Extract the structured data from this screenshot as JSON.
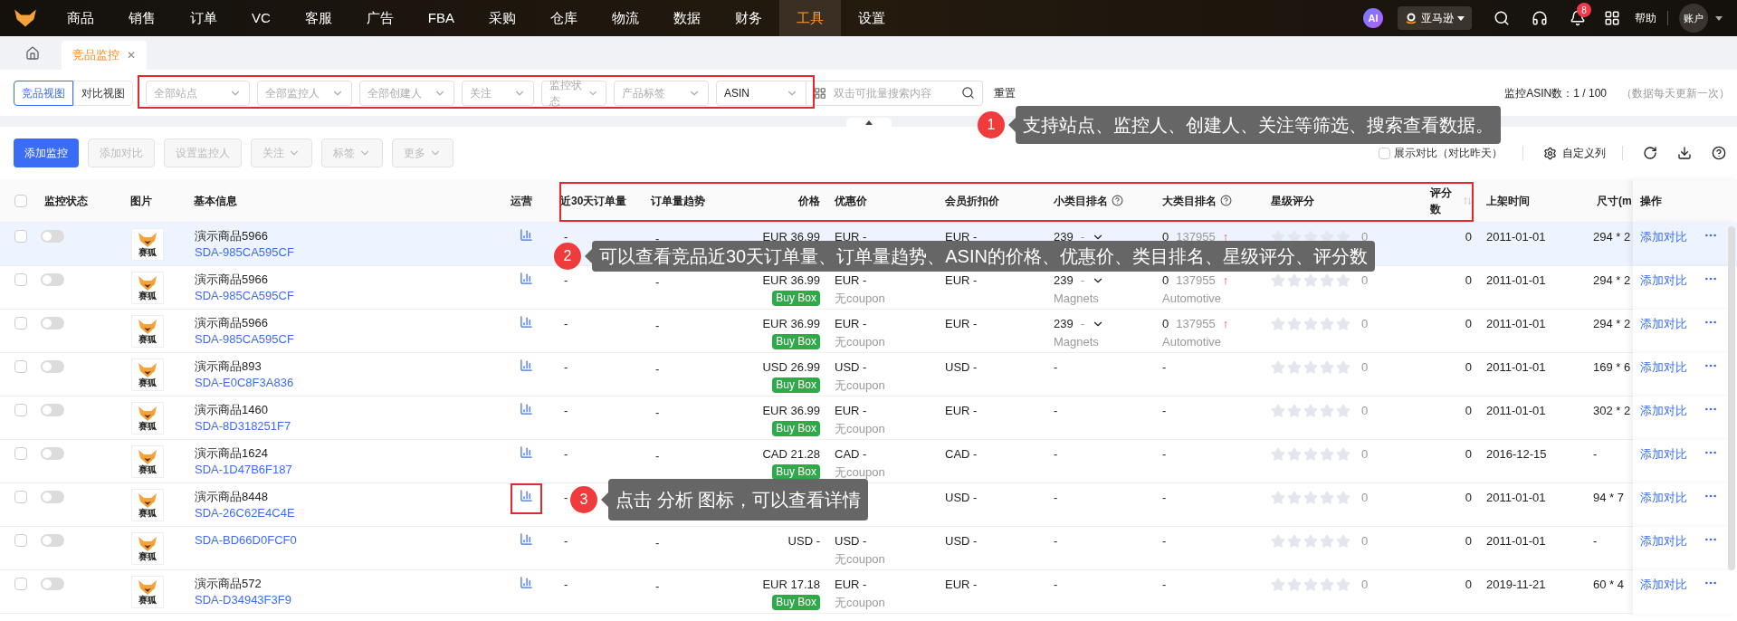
{
  "nav": {
    "items": [
      {
        "label": "商品",
        "selected": false
      },
      {
        "label": "销售",
        "selected": false
      },
      {
        "label": "订单",
        "selected": false
      },
      {
        "label": "VC",
        "selected": false
      },
      {
        "label": "客服",
        "selected": false
      },
      {
        "label": "广告",
        "selected": false
      },
      {
        "label": "FBA",
        "selected": false
      },
      {
        "label": "采购",
        "selected": false
      },
      {
        "label": "仓库",
        "selected": false
      },
      {
        "label": "物流",
        "selected": false
      },
      {
        "label": "数据",
        "selected": false
      },
      {
        "label": "财务",
        "selected": false
      },
      {
        "label": "工具",
        "selected": true
      },
      {
        "label": "设置",
        "selected": false
      }
    ],
    "ai": "AI",
    "marketplace": "亚马逊",
    "notifications": "8",
    "help": "帮助",
    "account": "账户"
  },
  "page_tabs": [
    {
      "label": "竞品监控",
      "selected": true,
      "close": "✕"
    }
  ],
  "views": [
    {
      "label": "竞品视图",
      "selected": true
    },
    {
      "label": "对比视图",
      "selected": false
    }
  ],
  "filters": [
    {
      "placeholder": "全部站点"
    },
    {
      "placeholder": "全部监控人"
    },
    {
      "placeholder": "全部创建人"
    },
    {
      "placeholder": "关注"
    },
    {
      "placeholder": "监控状态"
    },
    {
      "placeholder": "产品标签"
    }
  ],
  "search": {
    "field": "ASIN",
    "placeholder": "双击可批量搜索内容"
  },
  "reset": "重置",
  "asin_count": "监控ASIN数：1 / 100",
  "update_note": "（数据每天更新一次）",
  "actions": [
    {
      "label": "添加监控",
      "disabled": false,
      "menu": false
    },
    {
      "label": "添加对比",
      "disabled": true,
      "menu": false
    },
    {
      "label": "设置监控人",
      "disabled": true,
      "menu": false
    },
    {
      "label": "关注",
      "disabled": true,
      "menu": true
    },
    {
      "label": "标签",
      "disabled": true,
      "menu": true
    },
    {
      "label": "更多",
      "disabled": true,
      "menu": true
    }
  ],
  "compare": {
    "label": "展示对比（对比昨天）",
    "checked": false
  },
  "custom_columns": "自定义列",
  "table": {
    "select_all_checked": false,
    "columns": [
      "监控状态",
      "图片",
      "基本信息",
      "运营",
      "近30天订单量",
      "订单量趋势",
      "价格",
      "优惠价",
      "会员折扣价",
      "小类目排名",
      "大类目排名",
      "星级评分",
      "评分数",
      "上架时间",
      "尺寸(m",
      "操作"
    ],
    "rows": [
      {
        "selected": true,
        "checked": false,
        "on": false,
        "logo": "赛狐",
        "name": "演示商品5966",
        "sku": "SDA-985CA595CF",
        "orders": "-",
        "trend": "-",
        "price": "EUR 36.99",
        "coupon": "EUR -",
        "member": "EUR -",
        "small_rank": "239",
        "small_change": "-",
        "large_rank": "0",
        "large_prev": "137955",
        "large_arrow": "↑",
        "stars": 0,
        "rating": "0",
        "reviews": "0",
        "date": "2011-01-01",
        "size": "294 * 2",
        "op": "添加对比"
      },
      {
        "selected": false,
        "checked": false,
        "on": false,
        "logo": "赛狐",
        "name": "演示商品5966",
        "sku": "SDA-985CA595CF",
        "orders": "-",
        "trend": "-",
        "price": "EUR 36.99",
        "buybox": "Buy Box",
        "coupon": "EUR -",
        "coupon_note": "无coupon",
        "member": "EUR -",
        "small_rank": "239",
        "small_change": "-",
        "small_cat": "Magnets",
        "large_rank": "0",
        "large_prev": "137955",
        "large_arrow": "↑",
        "large_cat": "Automotive",
        "stars": 0,
        "rating": "0",
        "reviews": "0",
        "date": "2011-01-01",
        "size": "294 * 2",
        "op": "添加对比"
      },
      {
        "selected": false,
        "checked": false,
        "on": false,
        "logo": "赛狐",
        "name": "演示商品5966",
        "sku": "SDA-985CA595CF",
        "orders": "-",
        "trend": "-",
        "price": "EUR 36.99",
        "buybox": "Buy Box",
        "coupon": "EUR -",
        "coupon_note": "无coupon",
        "member": "EUR -",
        "small_rank": "239",
        "small_change": "-",
        "small_cat": "Magnets",
        "large_rank": "0",
        "large_prev": "137955",
        "large_arrow": "↑",
        "large_cat": "Automotive",
        "stars": 0,
        "rating": "0",
        "reviews": "0",
        "date": "2011-01-01",
        "size": "294 * 2",
        "op": "添加对比"
      },
      {
        "selected": false,
        "checked": false,
        "on": false,
        "logo": "赛狐",
        "name": "演示商品893",
        "sku": "SDA-E0C8F3A836",
        "orders": "-",
        "trend": "-",
        "price": "USD 26.99",
        "buybox": "Buy Box",
        "coupon": "USD -",
        "coupon_note": "无coupon",
        "member": "USD -",
        "small_rank": "-",
        "large_rank": "-",
        "stars": 0,
        "rating": "0",
        "reviews": "0",
        "date": "2011-01-01",
        "size": "169 * 6",
        "op": "添加对比"
      },
      {
        "selected": false,
        "checked": false,
        "on": false,
        "logo": "赛狐",
        "name": "演示商品1460",
        "sku": "SDA-8D318251F7",
        "orders": "-",
        "trend": "-",
        "price": "EUR 36.99",
        "buybox": "Buy Box",
        "coupon": "EUR -",
        "coupon_note": "无coupon",
        "member": "EUR -",
        "small_rank": "-",
        "large_rank": "-",
        "stars": 0,
        "rating": "0",
        "reviews": "0",
        "date": "2011-01-01",
        "size": "302 * 2",
        "op": "添加对比"
      },
      {
        "selected": false,
        "checked": false,
        "on": false,
        "logo": "赛狐",
        "name": "演示商品1624",
        "sku": "SDA-1D47B6F187",
        "orders": "-",
        "trend": "-",
        "price": "CAD 21.28",
        "buybox": "Buy Box",
        "coupon": "CAD -",
        "coupon_note": "无coupon",
        "member": "CAD -",
        "small_rank": "-",
        "large_rank": "-",
        "stars": 0,
        "rating": "0",
        "reviews": "0",
        "date": "2016-12-15",
        "size": "-",
        "op": "添加对比"
      },
      {
        "selected": false,
        "checked": false,
        "on": false,
        "logo": "赛狐",
        "name": "演示商品8448",
        "sku": "SDA-26C62E4C4E",
        "orders": "-",
        "member": "USD -",
        "small_rank": "-",
        "large_rank": "-",
        "stars": 0,
        "rating": "0",
        "reviews": "0",
        "date": "2011-01-01",
        "size": "94 * 7",
        "op": "添加对比"
      },
      {
        "selected": false,
        "checked": false,
        "on": false,
        "logo": "赛狐",
        "sku": "SDA-BD66D0FCF0",
        "orders": "-",
        "trend": "-",
        "price": "USD -",
        "coupon": "USD -",
        "coupon_note": "无coupon",
        "member": "USD -",
        "small_rank": "-",
        "large_rank": "-",
        "stars": 0,
        "rating": "0",
        "reviews": "0",
        "date": "2011-01-01",
        "size": "-",
        "op": "添加对比"
      },
      {
        "selected": false,
        "checked": false,
        "on": false,
        "logo": "赛狐",
        "name": "演示商品572",
        "sku": "SDA-D34943F3F9",
        "orders": "-",
        "trend": "-",
        "price": "EUR 17.18",
        "buybox": "Buy Box",
        "coupon": "EUR -",
        "coupon_note": "无coupon",
        "member": "EUR -",
        "small_rank": "-",
        "large_rank": "-",
        "stars": 0,
        "rating": "0",
        "reviews": "0",
        "date": "2019-11-21",
        "size": "60 * 4",
        "op": "添加对比"
      }
    ]
  },
  "tips": [
    {
      "number": "1",
      "text": "支持站点、监控人、创建人、关注等筛选、搜索查看数据。"
    },
    {
      "number": "2",
      "text": "可以查看竞品近30天订单量、订单量趋势、ASIN的价格、优惠价、类目排名、星级评分、评分数"
    },
    {
      "number": "3",
      "text": "点击 分析 图标，可以查看详情"
    }
  ]
}
